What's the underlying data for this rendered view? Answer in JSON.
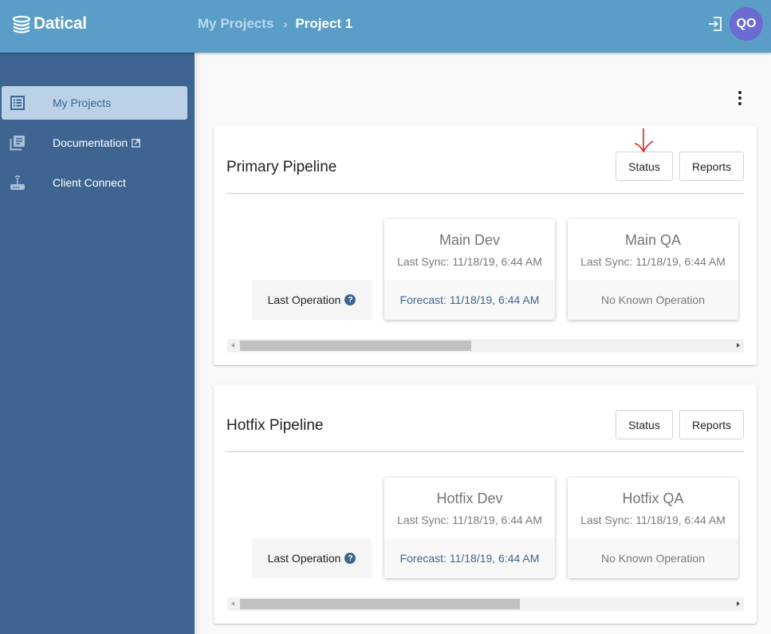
{
  "header": {
    "logo_text": "Datical",
    "breadcrumb": [
      {
        "label": "My Projects"
      },
      {
        "label": "Project 1"
      }
    ],
    "breadcrumb_separator": "›",
    "logout_icon": "logout-icon",
    "avatar_initials": "QO",
    "colors": {
      "topbar": "#5a9ec8",
      "avatar": "#6b6bd1"
    }
  },
  "sidebar": {
    "items": [
      {
        "label": "My Projects",
        "icon": "list-icon",
        "active": true
      },
      {
        "label": "Documentation",
        "icon": "book-icon",
        "external": true
      },
      {
        "label": "Client Connect",
        "icon": "router-icon"
      }
    ],
    "colors": {
      "background": "#3e6591",
      "active": "#bad1e7"
    }
  },
  "main": {
    "more_menu_icon": "kebab-menu-icon",
    "pipelines": [
      {
        "title": "Primary Pipeline",
        "status_label": "Status",
        "reports_label": "Reports",
        "last_operation_label": "Last Operation",
        "environments": [
          {
            "name": "Main Dev",
            "last_sync": "Last Sync: 11/18/19, 6:44 AM",
            "operation": "Forecast: 11/18/19, 6:44 AM",
            "operation_type": "forecast"
          },
          {
            "name": "Main QA",
            "last_sync": "Last Sync: 11/18/19, 6:44 AM",
            "operation": "No Known Operation",
            "operation_type": "none"
          }
        ],
        "scroll_fraction_visible": 0.47
      },
      {
        "title": "Hotfix Pipeline",
        "status_label": "Status",
        "reports_label": "Reports",
        "last_operation_label": "Last Operation",
        "environments": [
          {
            "name": "Hotfix Dev",
            "last_sync": "Last Sync: 11/18/19, 6:44 AM",
            "operation": "Forecast: 11/18/19, 6:44 AM",
            "operation_type": "forecast"
          },
          {
            "name": "Hotfix QA",
            "last_sync": "Last Sync: 11/18/19, 6:44 AM",
            "operation": "No Known Operation",
            "operation_type": "none"
          }
        ],
        "scroll_fraction_visible": 0.57
      }
    ]
  },
  "annotation": {
    "type": "red-arrow",
    "target": "Status",
    "color": "#e02020"
  }
}
